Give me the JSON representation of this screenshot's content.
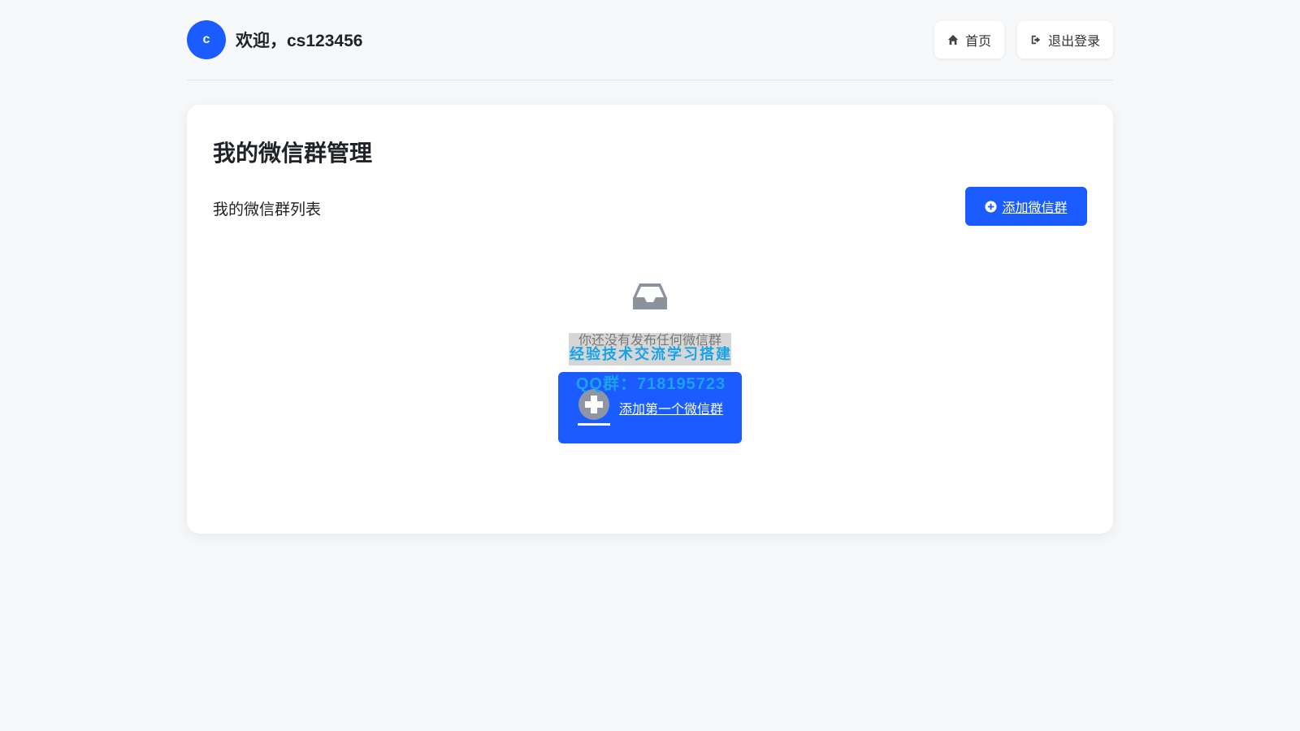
{
  "header": {
    "avatar_letter": "c",
    "welcome": "欢迎，cs123456",
    "home_label": "首页",
    "logout_label": "退出登录"
  },
  "card": {
    "title": "我的微信群管理",
    "list_label": "我的微信群列表",
    "add_button_label": "添加微信群",
    "empty_text": "你还没有发布任何微信群",
    "add_first_label": "添加第一个微信群"
  },
  "watermark": {
    "line1": "经验技术交流学习搭建",
    "line2": "QQ群：718195723"
  },
  "colors": {
    "primary": "#1a5cff",
    "background": "#f6f8fa",
    "watermark": "#1aa3e6"
  }
}
